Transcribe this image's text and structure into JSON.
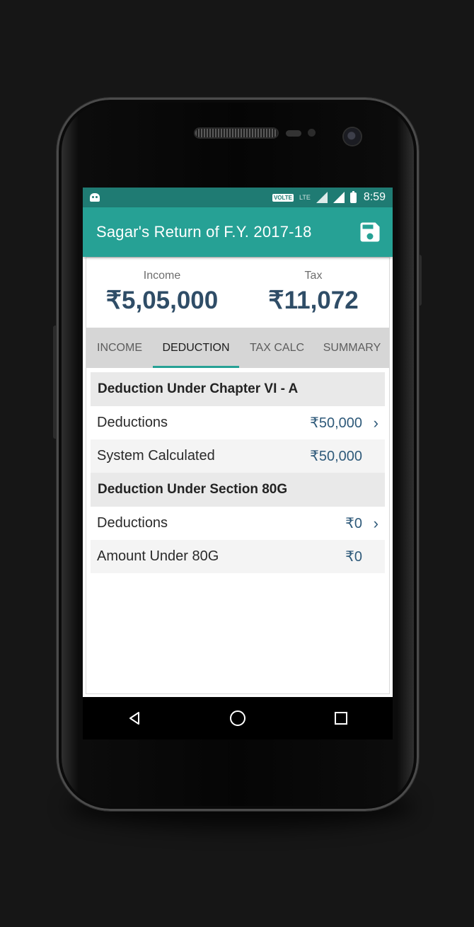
{
  "statusbar": {
    "network_badge": "VOLTE",
    "lte_label": "LTE",
    "time": "8:59"
  },
  "appbar": {
    "title": "Sagar's Return of F.Y. 2017-18",
    "save_icon": "save-icon"
  },
  "summary": {
    "income_label": "Income",
    "income_value": "₹5,05,000",
    "tax_label": "Tax",
    "tax_value": "₹11,072"
  },
  "tabs": [
    {
      "label": "INCOME",
      "active": false
    },
    {
      "label": "DEDUCTION",
      "active": true
    },
    {
      "label": "TAX CALC",
      "active": false
    },
    {
      "label": "SUMMARY",
      "active": false
    }
  ],
  "sections": [
    {
      "title": "Deduction Under Chapter VI - A",
      "rows": [
        {
          "label": "Deductions",
          "value": "₹50,000",
          "has_chevron": true
        },
        {
          "label": "System Calculated",
          "value": "₹50,000",
          "has_chevron": false
        }
      ]
    },
    {
      "title": "Deduction Under Section 80G",
      "rows": [
        {
          "label": "Deductions",
          "value": "₹0",
          "has_chevron": true
        },
        {
          "label": "Amount Under 80G",
          "value": "₹0",
          "has_chevron": false
        }
      ]
    }
  ],
  "navbar": {
    "back_icon": "back-triangle-icon",
    "home_icon": "home-circle-icon",
    "recents_icon": "recents-square-icon"
  },
  "colors": {
    "statusbar": "#1f7b73",
    "appbar": "#26a195",
    "accent_text": "#2f4d67",
    "value_text": "#2f5a7a"
  }
}
